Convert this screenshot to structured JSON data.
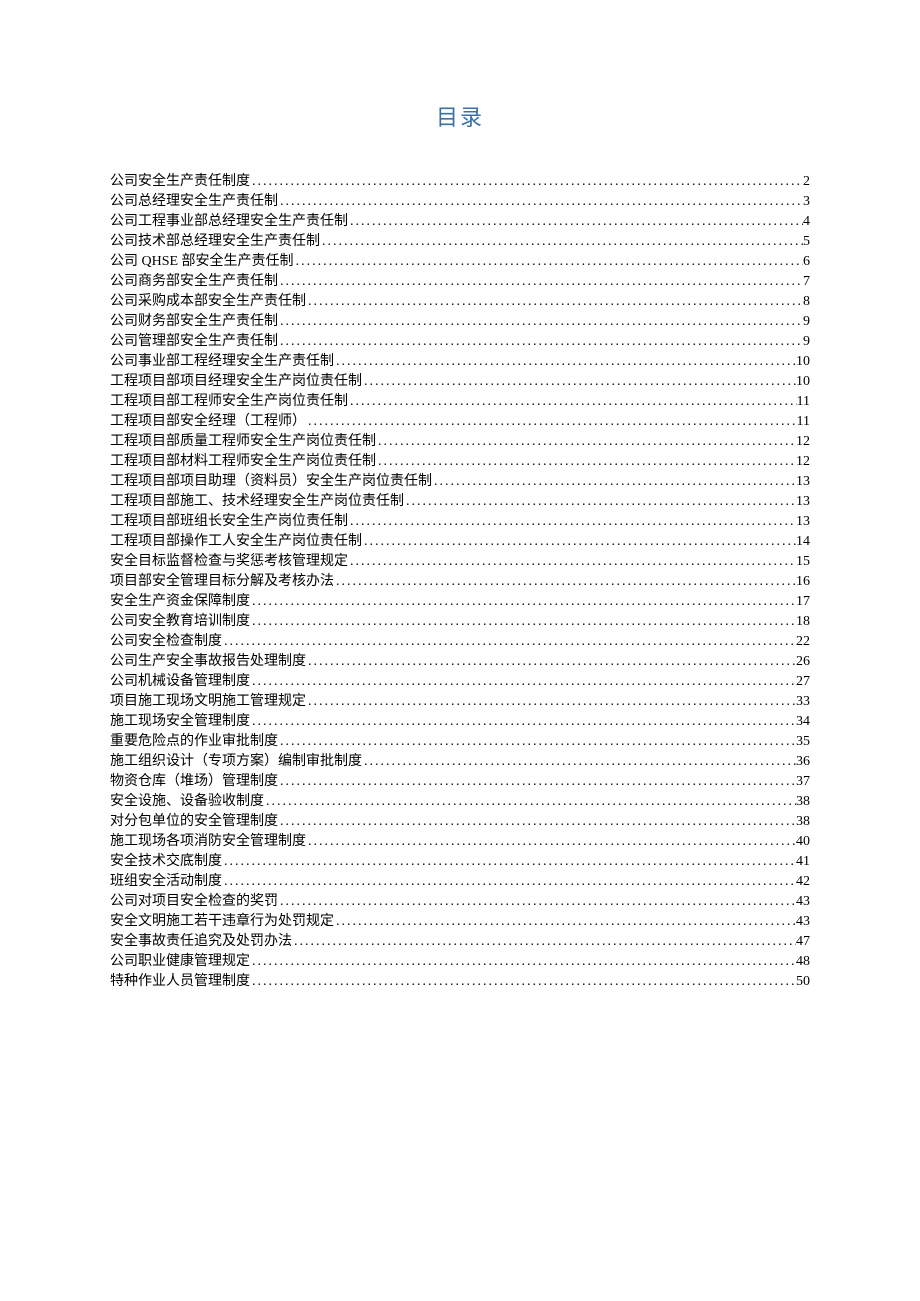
{
  "title": "目录",
  "toc": [
    {
      "label": "公司安全生产责任制度",
      "page": "2"
    },
    {
      "label": "公司总经理安全生产责任制",
      "page": "3"
    },
    {
      "label": "公司工程事业部总经理安全生产责任制",
      "page": "4"
    },
    {
      "label": "公司技术部总经理安全生产责任制",
      "page": "5"
    },
    {
      "label": "公司 QHSE 部安全生产责任制",
      "page": "6"
    },
    {
      "label": "公司商务部安全生产责任制",
      "page": "7"
    },
    {
      "label": "公司采购成本部安全生产责任制",
      "page": "8"
    },
    {
      "label": "公司财务部安全生产责任制",
      "page": "9"
    },
    {
      "label": "公司管理部安全生产责任制",
      "page": "9"
    },
    {
      "label": "公司事业部工程经理安全生产责任制",
      "page": "10"
    },
    {
      "label": "工程项目部项目经理安全生产岗位责任制",
      "page": "10"
    },
    {
      "label": "工程项目部工程师安全生产岗位责任制",
      "page": "11"
    },
    {
      "label": "工程项目部安全经理（工程师）",
      "page": "11"
    },
    {
      "label": "工程项目部质量工程师安全生产岗位责任制",
      "page": "12"
    },
    {
      "label": "工程项目部材料工程师安全生产岗位责任制",
      "page": "12"
    },
    {
      "label": "工程项目部项目助理（资料员）安全生产岗位责任制",
      "page": "13"
    },
    {
      "label": "工程项目部施工、技术经理安全生产岗位责任制",
      "page": "13"
    },
    {
      "label": "工程项目部班组长安全生产岗位责任制",
      "page": "13"
    },
    {
      "label": "工程项目部操作工人安全生产岗位责任制",
      "page": "14"
    },
    {
      "label": "安全目标监督检查与奖惩考核管理规定",
      "page": "15"
    },
    {
      "label": "项目部安全管理目标分解及考核办法",
      "page": "16"
    },
    {
      "label": "安全生产资金保障制度",
      "page": "17"
    },
    {
      "label": "公司安全教育培训制度",
      "page": "18"
    },
    {
      "label": "公司安全检查制度",
      "page": "22"
    },
    {
      "label": "公司生产安全事故报告处理制度",
      "page": "26"
    },
    {
      "label": "公司机械设备管理制度",
      "page": "27"
    },
    {
      "label": "项目施工现场文明施工管理规定",
      "page": "33"
    },
    {
      "label": "施工现场安全管理制度",
      "page": "34"
    },
    {
      "label": "重要危险点的作业审批制度",
      "page": "35"
    },
    {
      "label": "施工组织设计（专项方案）编制审批制度",
      "page": "36"
    },
    {
      "label": "物资仓库（堆场）管理制度",
      "page": "37"
    },
    {
      "label": "安全设施、设备验收制度",
      "page": "38"
    },
    {
      "label": "对分包单位的安全管理制度",
      "page": "38"
    },
    {
      "label": "施工现场各项消防安全管理制度",
      "page": "40"
    },
    {
      "label": "安全技术交底制度",
      "page": "41"
    },
    {
      "label": "班组安全活动制度",
      "page": "42"
    },
    {
      "label": "公司对项目安全检查的奖罚",
      "page": "43"
    },
    {
      "label": "安全文明施工若干违章行为处罚规定",
      "page": "43"
    },
    {
      "label": "安全事故责任追究及处罚办法",
      "page": "47"
    },
    {
      "label": "公司职业健康管理规定",
      "page": "48"
    },
    {
      "label": "特种作业人员管理制度",
      "page": "50"
    }
  ]
}
